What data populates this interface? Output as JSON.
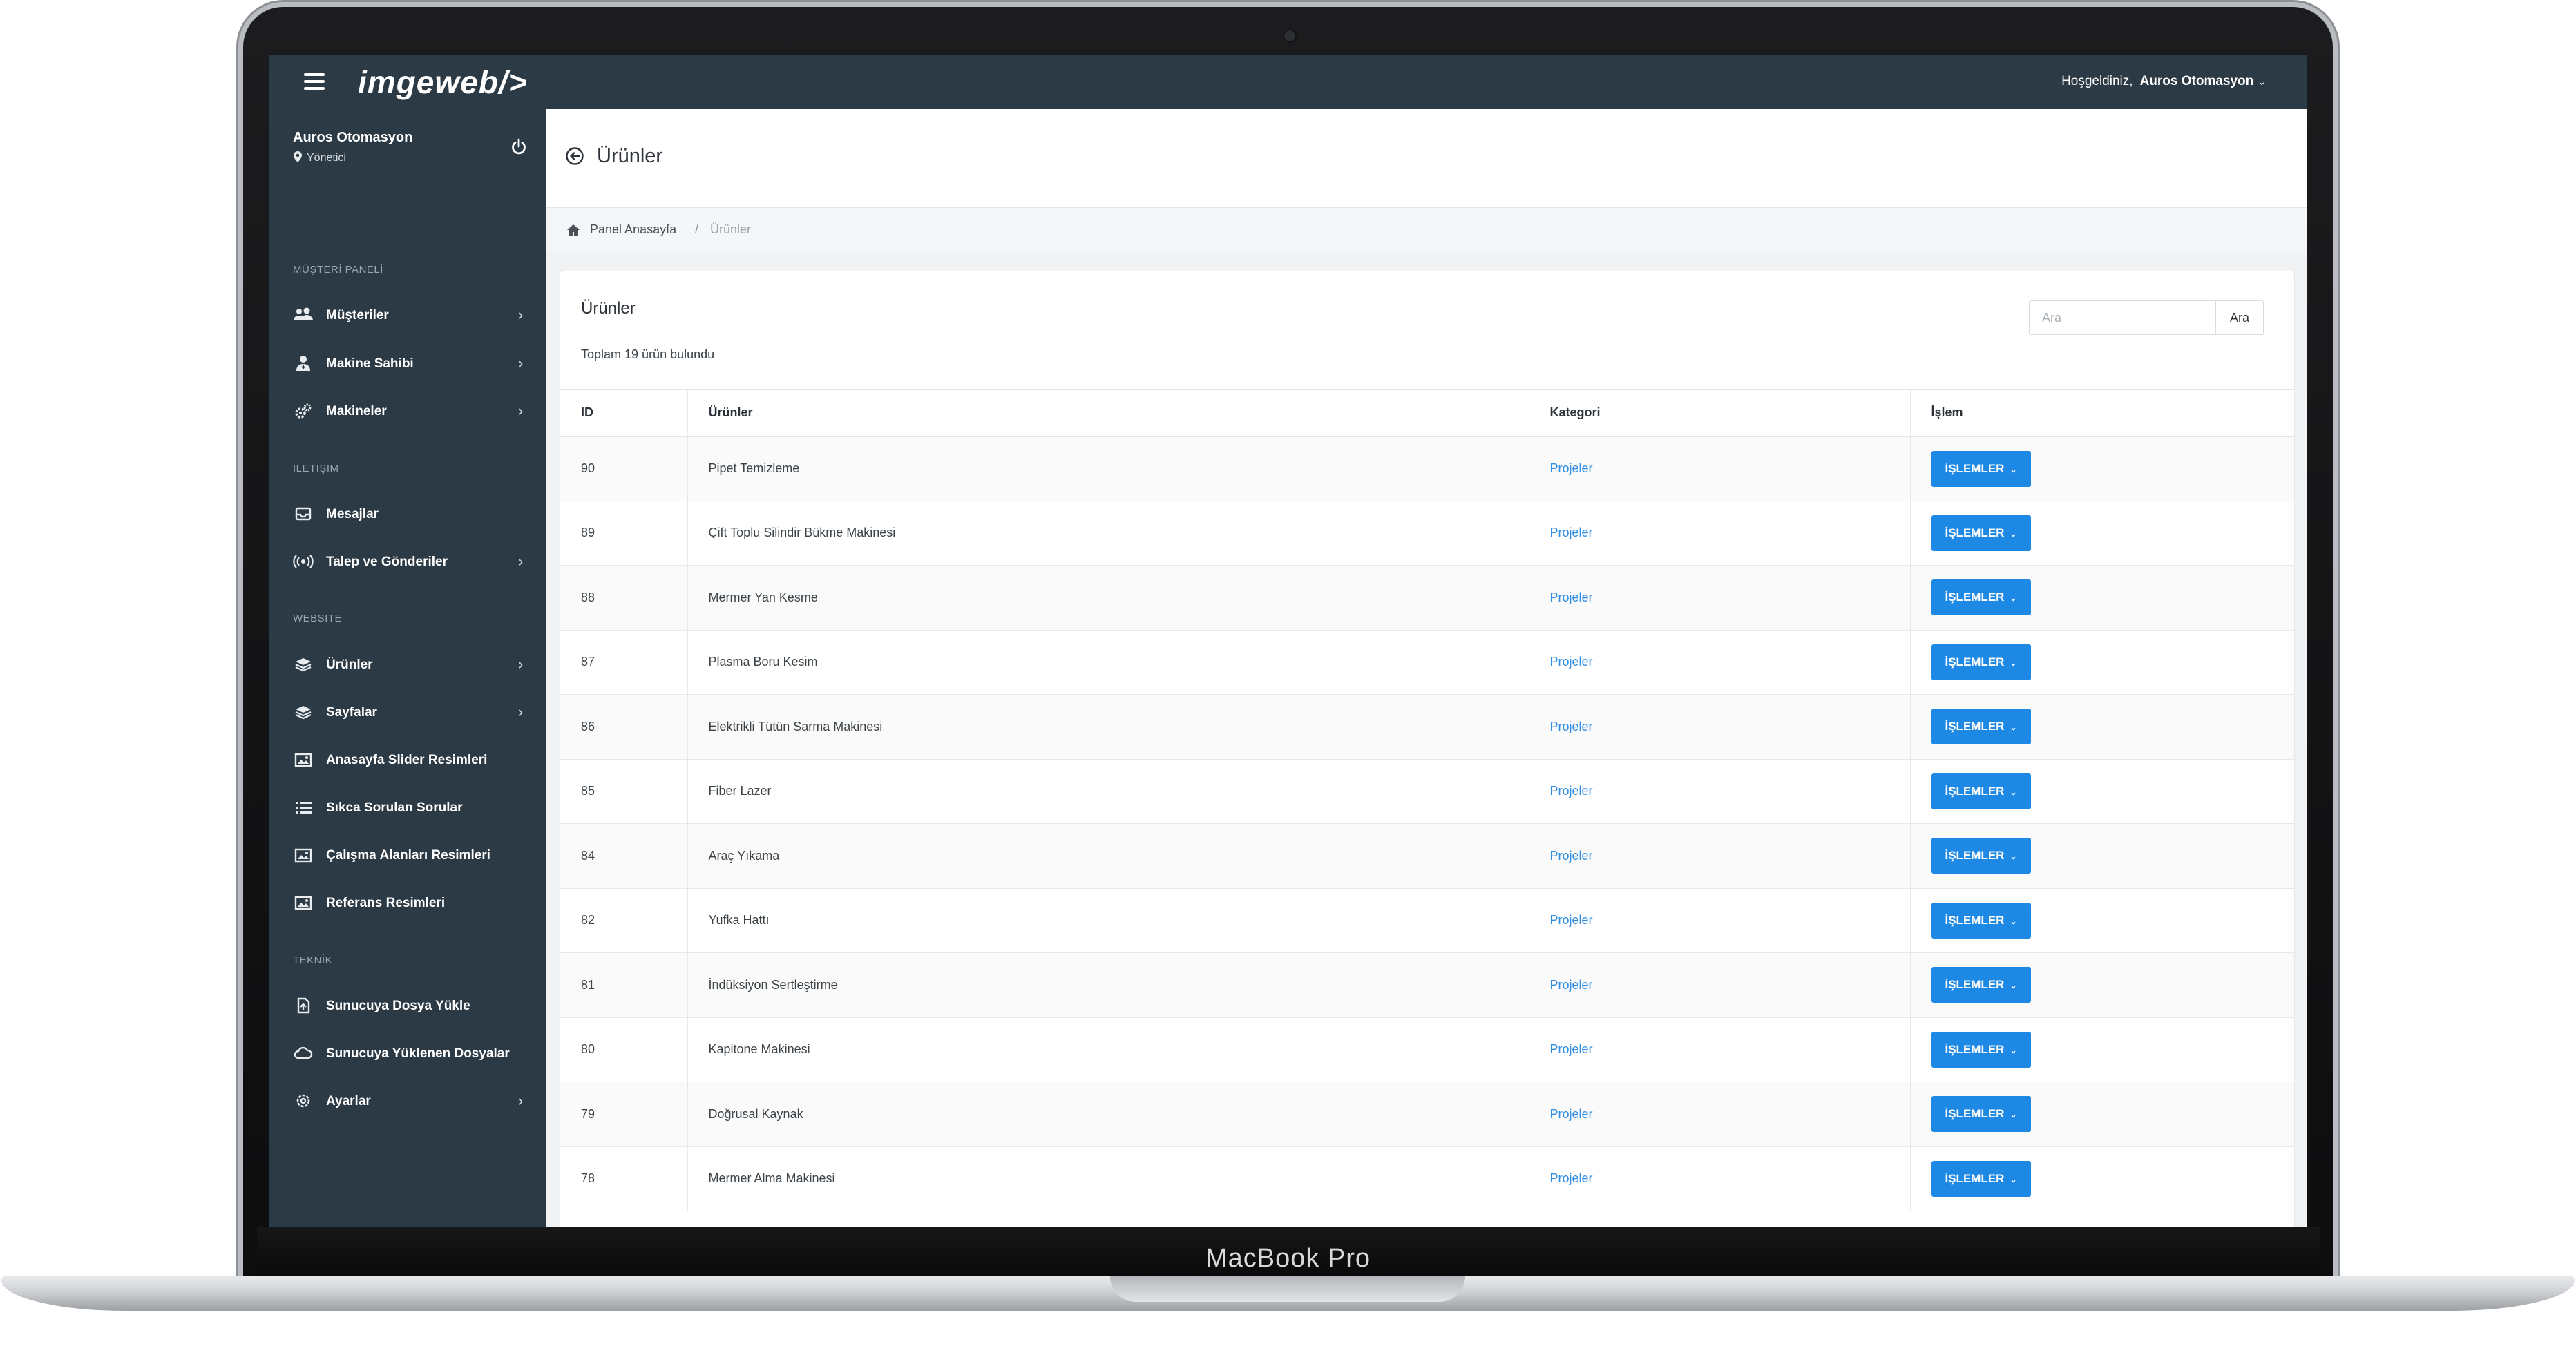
{
  "device": {
    "label": "MacBook Pro"
  },
  "topbar": {
    "logo": "imgeweb/>",
    "welcome": "Hoşgeldiniz,",
    "user": "Auros Otomasyon"
  },
  "sidebar": {
    "profile": {
      "name": "Auros Otomasyon",
      "role": "Yönetici"
    },
    "sections": [
      {
        "title": "MÜŞTERİ PANELİ"
      },
      {
        "title": "İLETİŞİM"
      },
      {
        "title": "WEBSITE"
      },
      {
        "title": "TEKNİK"
      }
    ],
    "items": [
      {
        "label": "Müşteriler",
        "icon": "users-icon",
        "arrow": true
      },
      {
        "label": "Makine Sahibi",
        "icon": "user-tie-icon",
        "arrow": true
      },
      {
        "label": "Makineler",
        "icon": "gears-icon",
        "arrow": true
      },
      {
        "label": "Mesajlar",
        "icon": "inbox-icon",
        "arrow": false
      },
      {
        "label": "Talep ve Gönderiler",
        "icon": "broadcast-icon",
        "arrow": true
      },
      {
        "label": "Ürünler",
        "icon": "layers-icon",
        "arrow": true
      },
      {
        "label": "Sayfalar",
        "icon": "layers-icon",
        "arrow": true
      },
      {
        "label": "Anasayfa Slider Resimleri",
        "icon": "image-icon",
        "arrow": false
      },
      {
        "label": "Sıkca Sorulan Sorular",
        "icon": "list-icon",
        "arrow": false
      },
      {
        "label": "Çalışma Alanları Resimleri",
        "icon": "image-icon",
        "arrow": false
      },
      {
        "label": "Referans Resimleri",
        "icon": "image-icon",
        "arrow": false
      },
      {
        "label": "Sunucuya Dosya Yükle",
        "icon": "file-upload-icon",
        "arrow": false
      },
      {
        "label": "Sunucuya Yüklenen Dosyalar",
        "icon": "cloud-icon",
        "arrow": false
      },
      {
        "label": "Ayarlar",
        "icon": "gear-icon",
        "arrow": true
      }
    ]
  },
  "page": {
    "title": "Ürünler",
    "breadcrumb": {
      "home": "Panel Anasayfa",
      "separator": "/",
      "current": "Ürünler"
    }
  },
  "card": {
    "title": "Ürünler",
    "summary": "Toplam 19 ürün bulundu",
    "search": {
      "placeholder": "Ara",
      "button": "Ara"
    }
  },
  "table": {
    "columns": [
      "ID",
      "Ürünler",
      "Kategori",
      "İşlem"
    ],
    "action_label": "İŞLEMLER",
    "rows": [
      {
        "id": "90",
        "name": "Pipet Temizleme",
        "category": "Projeler"
      },
      {
        "id": "89",
        "name": "Çift Toplu Silindir Bükme Makinesi",
        "category": "Projeler"
      },
      {
        "id": "88",
        "name": "Mermer Yan Kesme",
        "category": "Projeler"
      },
      {
        "id": "87",
        "name": "Plasma Boru Kesim",
        "category": "Projeler"
      },
      {
        "id": "86",
        "name": "Elektrikli Tütün Sarma Makinesi",
        "category": "Projeler"
      },
      {
        "id": "85",
        "name": "Fiber Lazer",
        "category": "Projeler"
      },
      {
        "id": "84",
        "name": "Araç Yıkama",
        "category": "Projeler"
      },
      {
        "id": "82",
        "name": "Yufka Hattı",
        "category": "Projeler"
      },
      {
        "id": "81",
        "name": "İndüksiyon Sertleştirme",
        "category": "Projeler"
      },
      {
        "id": "80",
        "name": "Kapitone Makinesi",
        "category": "Projeler"
      },
      {
        "id": "79",
        "name": "Doğrusal Kaynak",
        "category": "Projeler"
      },
      {
        "id": "78",
        "name": "Mermer Alma Makinesi",
        "category": "Projeler"
      }
    ]
  },
  "colors": {
    "sidebar_bg": "#2b3a44",
    "primary_button": "#1e88e5",
    "link": "#2f8de4"
  }
}
